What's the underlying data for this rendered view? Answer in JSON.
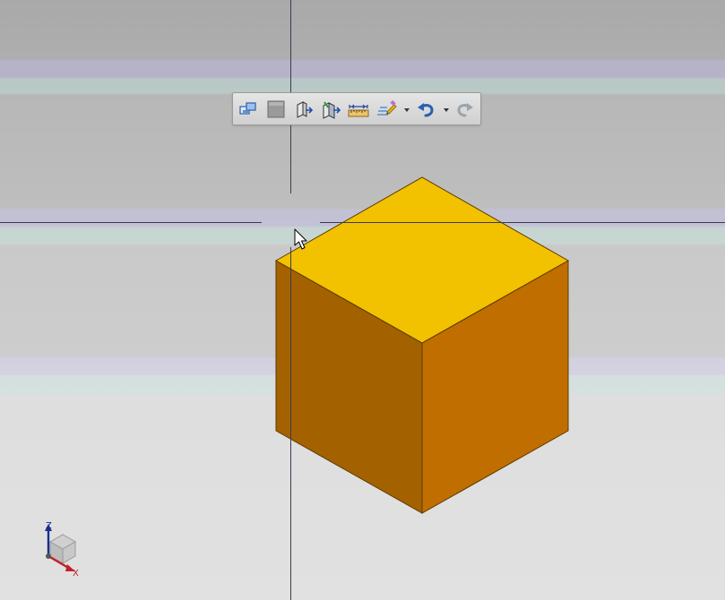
{
  "viewport": {
    "background_bands": [
      "#aeaeae",
      "#b6b3c8",
      "#b9c8c6",
      "#bebebe",
      "#c2c0d2",
      "#c6d5d2",
      "#cdcdcd",
      "#d3d1e0",
      "#d5e1df",
      "#e1e1e1"
    ]
  },
  "cube": {
    "top_color": "#f2c100",
    "left_color": "#a36100",
    "right_color": "#c06e00",
    "edge_color": "#5a3a00"
  },
  "toolbar": {
    "buttons": [
      {
        "name": "view-orientation-icon",
        "tooltip": ""
      },
      {
        "name": "display-style-icon",
        "tooltip": ""
      },
      {
        "name": "section-view-icon",
        "tooltip": ""
      },
      {
        "name": "view-selected-icon",
        "tooltip": ""
      },
      {
        "name": "measure-icon",
        "tooltip": ""
      },
      {
        "name": "quick-access-icon",
        "tooltip": ""
      },
      {
        "name": "undo-icon",
        "tooltip": ""
      },
      {
        "name": "redo-icon",
        "tooltip": ""
      }
    ]
  },
  "axis_triad": {
    "z_label": "Z",
    "x_label": "X",
    "z_color": "#1a2e8c",
    "x_color": "#c0212a"
  }
}
